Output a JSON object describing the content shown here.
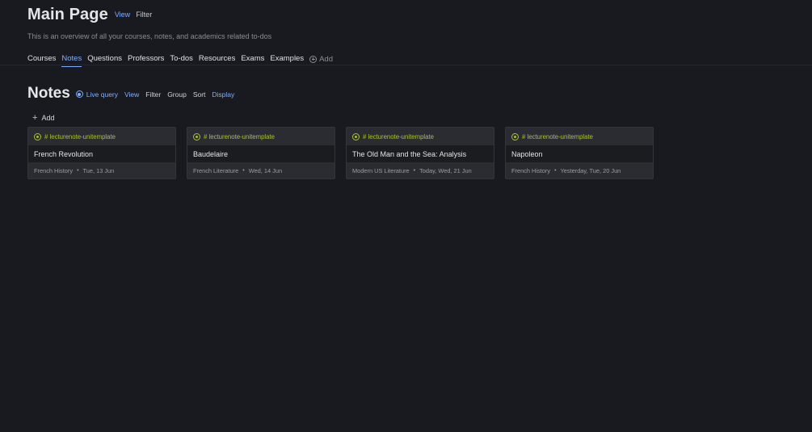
{
  "header": {
    "title": "Main Page",
    "view_label": "View",
    "filter_label": "Filter",
    "description": "This is an overview of all your courses, notes, and academics related to-dos"
  },
  "tabs": [
    {
      "label": "Courses",
      "active": false
    },
    {
      "label": "Notes",
      "active": true
    },
    {
      "label": "Questions",
      "active": false
    },
    {
      "label": "Professors",
      "active": false
    },
    {
      "label": "To-dos",
      "active": false
    },
    {
      "label": "Resources",
      "active": false
    },
    {
      "label": "Exams",
      "active": false
    },
    {
      "label": "Examples",
      "active": false
    }
  ],
  "tab_add_label": "Add",
  "section": {
    "title": "Notes",
    "live_query_label": "Live query",
    "view_label": "View",
    "filter_label": "Filter",
    "group_label": "Group",
    "sort_label": "Sort",
    "display_label": "Display",
    "add_label": "Add"
  },
  "cards": [
    {
      "tag": "# lecturenote-unitemplate",
      "title": "French Revolution",
      "course": "French History",
      "date": "Tue, 13 Jun"
    },
    {
      "tag": "# lecturenote-unitemplate",
      "title": "Baudelaire",
      "course": "French Literature",
      "date": "Wed, 14 Jun"
    },
    {
      "tag": "# lecturenote-unitemplate",
      "title": "The Old Man and the Sea: Analysis",
      "course": "Modern US Literature",
      "date": "Today, Wed, 21 Jun"
    },
    {
      "tag": "# lecturenote-unitemplate",
      "title": "Napoleon",
      "course": "French History",
      "date": "Yesterday, Tue, 20 Jun"
    }
  ],
  "colors": {
    "background": "#191a1f",
    "accent": "#7fb0ff",
    "tag": "#a4c52b"
  }
}
